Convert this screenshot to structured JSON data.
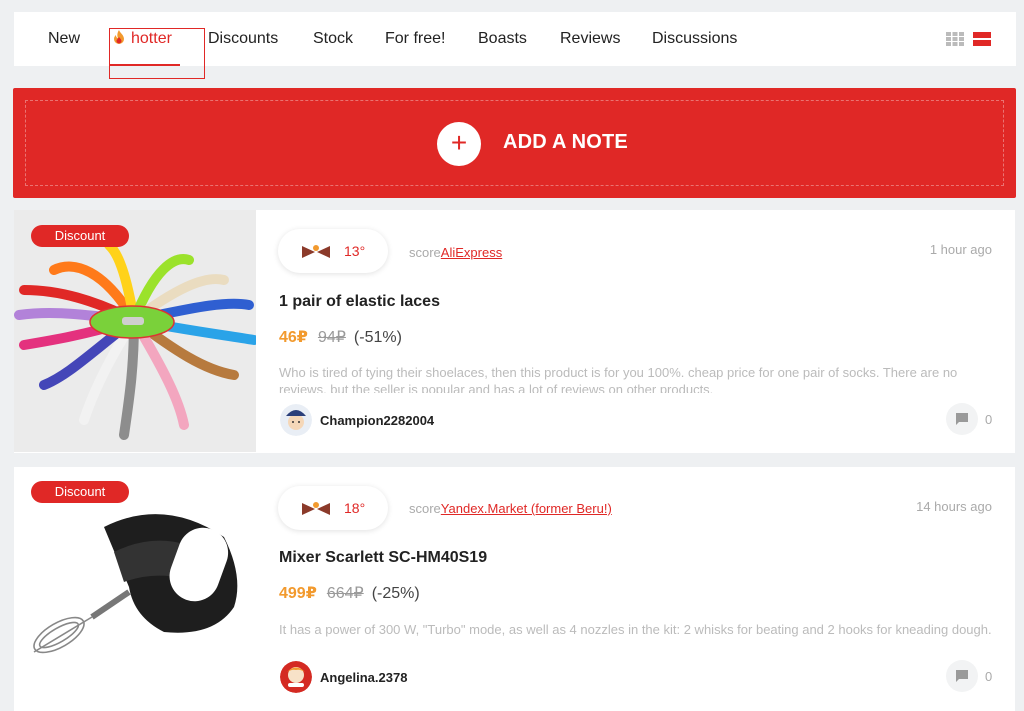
{
  "nav": {
    "tabs": [
      "New",
      "hotter",
      "Discounts",
      "Stock",
      "For free!",
      "Boasts",
      "Reviews",
      "Discussions"
    ],
    "active_tab": "hotter",
    "view_icons": [
      "grid-view-icon",
      "list-view-icon"
    ]
  },
  "banner": {
    "label": "ADD A NOTE",
    "plus": "+"
  },
  "deals": [
    {
      "badge": "Discount",
      "temperature": "13°",
      "score_label": "score",
      "shop": "AliExpress",
      "time": "1 hour ago",
      "title": "1 pair of elastic laces",
      "price_new": "46₽",
      "price_old": "94₽",
      "discount": "(-51%)",
      "description": "Who is tired of tying their shoelaces, then this product is for you 100%. cheap price for one pair of socks. There are no reviews, but the seller is popular and has a lot of reviews on other products.",
      "user": "Champion2282004",
      "comments": "0"
    },
    {
      "badge": "Discount",
      "temperature": "18°",
      "score_label": "score",
      "shop": "Yandex.Market (former Beru!)",
      "time": "14 hours ago",
      "title": "Mixer Scarlett SC-HM40S19",
      "price_new": "499₽",
      "price_old": "664₽",
      "discount": "(-25%)",
      "description": "It has a power of 300 W, \"Turbo\" mode, as well as 4 nozzles in the kit: 2 whisks for beating and 2 hooks for kneading dough.",
      "user": "Angelina.2378",
      "comments": "0"
    }
  ],
  "colors": {
    "accent": "#e02826",
    "price": "#f29a2e",
    "muted": "#aaaaaa"
  }
}
